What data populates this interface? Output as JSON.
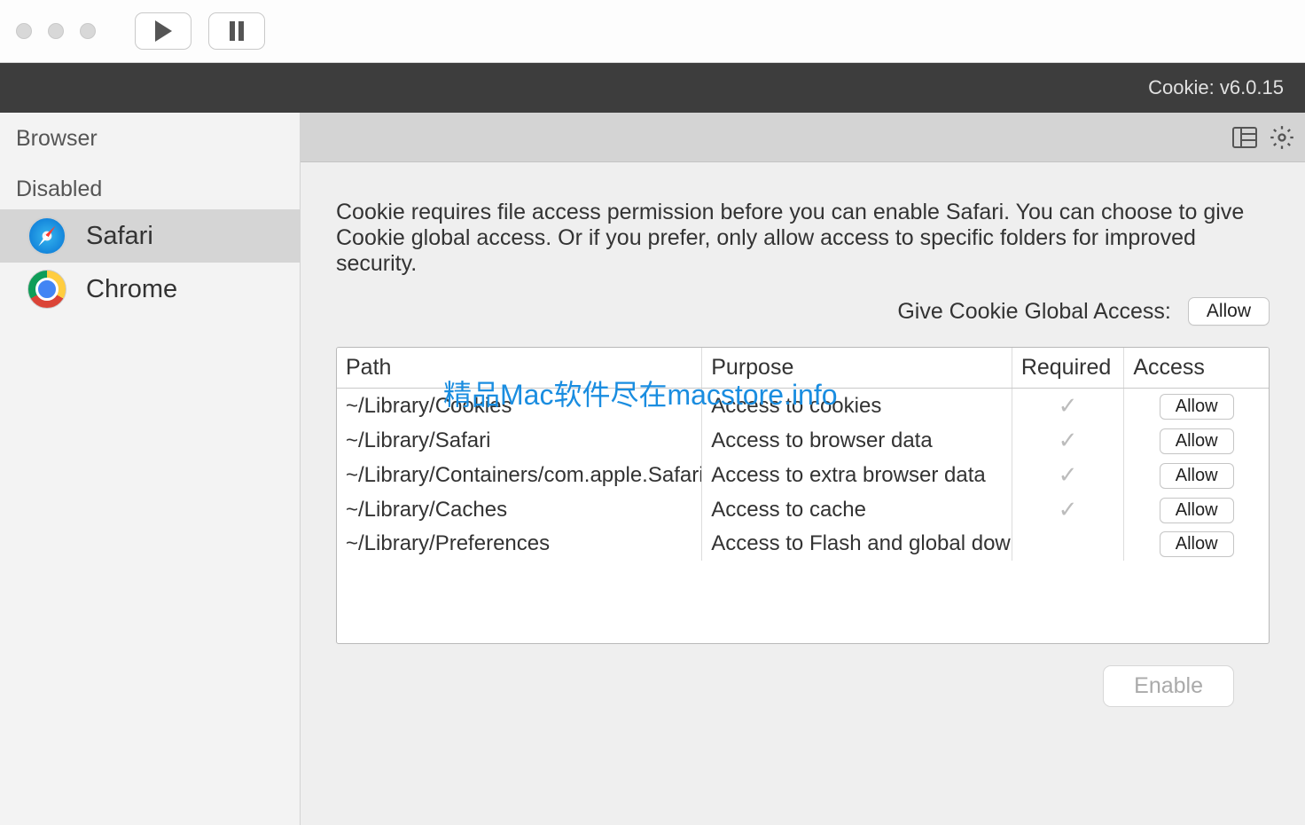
{
  "titlebar": {},
  "darkbar": {
    "version": "Cookie: v6.0.15"
  },
  "sidebar": {
    "header": "Browser",
    "section": "Disabled",
    "items": [
      {
        "name": "safari",
        "label": "Safari",
        "active": true
      },
      {
        "name": "chrome",
        "label": "Chrome",
        "active": false
      }
    ]
  },
  "content": {
    "notice": "Cookie requires file access permission before you can enable Safari. You can choose to give Cookie global access. Or if you prefer, only allow access to specific folders for improved security.",
    "global_label": "Give Cookie Global Access:",
    "global_button": "Allow",
    "columns": {
      "path": "Path",
      "purpose": "Purpose",
      "required": "Required",
      "access": "Access"
    },
    "rows": [
      {
        "path": "~/Library/Cookies",
        "purpose": "Access to cookies",
        "required": true,
        "allow": "Allow"
      },
      {
        "path": "~/Library/Safari",
        "purpose": "Access to browser data",
        "required": true,
        "allow": "Allow"
      },
      {
        "path": "~/Library/Containers/com.apple.Safari",
        "purpose": "Access to extra browser data",
        "required": true,
        "allow": "Allow"
      },
      {
        "path": "~/Library/Caches",
        "purpose": "Access to cache",
        "required": true,
        "allow": "Allow"
      },
      {
        "path": "~/Library/Preferences",
        "purpose": "Access to Flash and global downloads",
        "required": false,
        "allow": "Allow"
      }
    ],
    "enable": "Enable"
  },
  "watermark": "精品Mac软件尽在macstore.info"
}
